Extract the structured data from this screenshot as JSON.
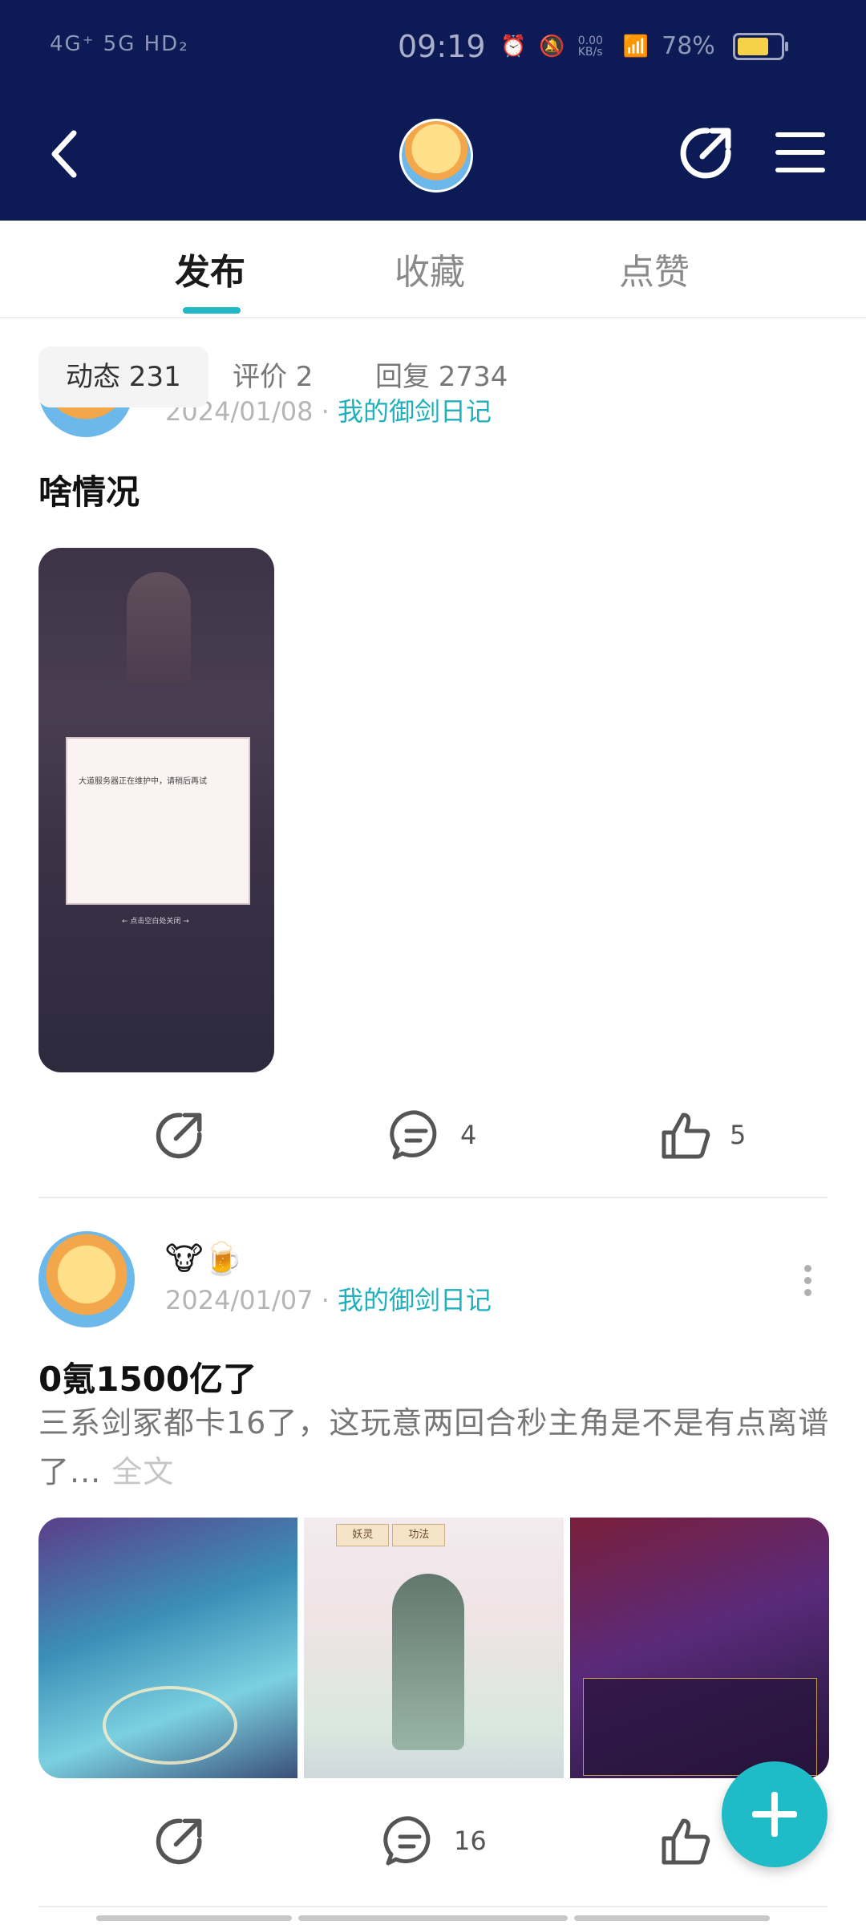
{
  "status_bar": {
    "left_indicators": "4G⁺  5G  HD₂",
    "time": "09:19",
    "speed": "0.00 KB/s",
    "battery_pct": "78%"
  },
  "tabs": [
    "发布",
    "收藏",
    "点赞"
  ],
  "filters": [
    "动态 231",
    "评价 2",
    "回复 2734"
  ],
  "posts": [
    {
      "date": "2024/01/08",
      "source": "我的御剑日记",
      "title": "啥情况",
      "image_text": "大道服务器正在维护中，请稍后再试",
      "image_back": "← 点击空白处关闭 →",
      "comments": "4",
      "likes": "5"
    },
    {
      "emoji": "🐮🍺",
      "date": "2024/01/07",
      "source": "我的御剑日记",
      "title": "0氪1500亿了",
      "excerpt": "三系剑冢都卡16了，这玩意两回合秒主角是不是有点离谱了",
      "ellipsis": "... ",
      "full_text": "全文",
      "thumb2_tabs": [
        "妖灵",
        "功法"
      ],
      "comments": "16"
    }
  ],
  "colors": {
    "header_bg": "#0c1a55",
    "accent": "#1fb8c4"
  }
}
